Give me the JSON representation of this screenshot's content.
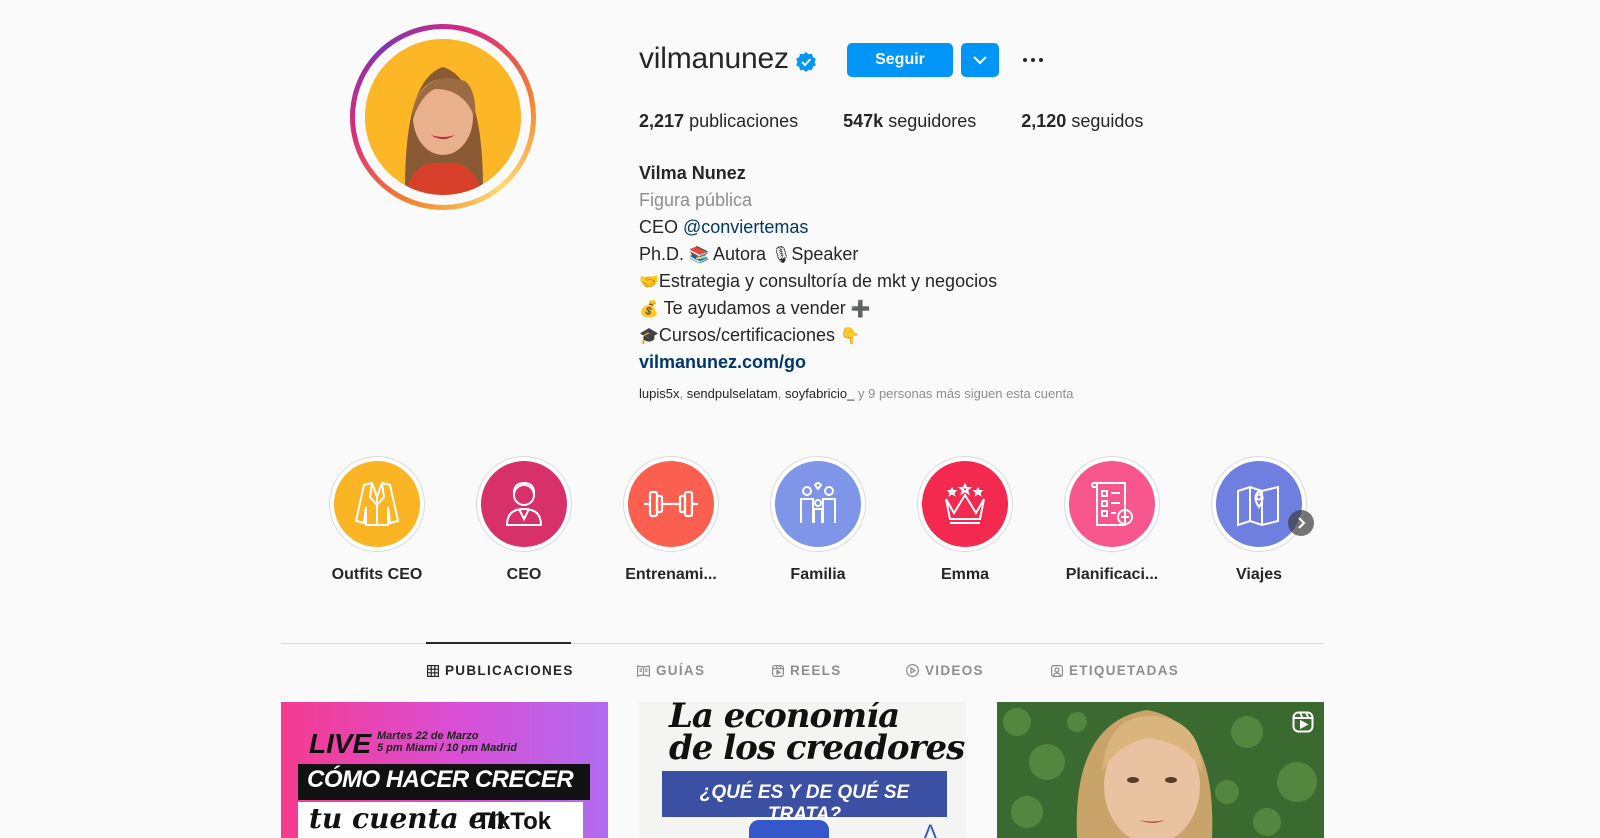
{
  "profile": {
    "username": "vilmanunez",
    "follow_label": "Seguir",
    "stats": {
      "posts_value": "2,217",
      "posts_label": "publicaciones",
      "followers_value": "547k",
      "followers_label": "seguidores",
      "following_value": "2,120",
      "following_label": "seguidos"
    },
    "bio": {
      "name": "Vilma Nunez",
      "category": "Figura pública",
      "line1_prefix": "CEO ",
      "line1_mention": "@conviertemas",
      "line2_a": "Ph.D. ",
      "line2_b": " Autora ",
      "line2_c": "Speaker",
      "line3": "Estrategia y consultoría de mkt y negocios",
      "line4": " Te ayudamos a vender",
      "line5": "Cursos/certificaciones",
      "website": "vilmanunez.com/go"
    },
    "followed_by": {
      "users": [
        "lupis5x",
        "sendpulselatam",
        "soyfabricio_"
      ],
      "suffix": " y 9 personas más siguen esta cuenta"
    }
  },
  "highlights": [
    {
      "label": "Outfits CEO",
      "color": "#fbb424",
      "icon": "blazer-icon"
    },
    {
      "label": "CEO",
      "color": "#d8316a",
      "icon": "businesswoman-icon"
    },
    {
      "label": "Entrenami...",
      "color": "#fb5f4f",
      "icon": "dumbbell-icon"
    },
    {
      "label": "Familia",
      "color": "#7e95e8",
      "icon": "family-icon"
    },
    {
      "label": "Emma",
      "color": "#f4294f",
      "icon": "crown-icon"
    },
    {
      "label": "Planificaci...",
      "color": "#f7578d",
      "icon": "checklist-icon"
    },
    {
      "label": "Viajes",
      "color": "#6e7fe0",
      "icon": "map-icon"
    }
  ],
  "tabs": [
    {
      "label": "PUBLICACIONES",
      "icon": "grid-icon",
      "active": true
    },
    {
      "label": "GUÍAS",
      "icon": "guide-icon",
      "active": false
    },
    {
      "label": "REELS",
      "icon": "reels-icon",
      "active": false
    },
    {
      "label": "VIDEOS",
      "icon": "video-icon",
      "active": false
    },
    {
      "label": "ETIQUETADAS",
      "icon": "tagged-icon",
      "active": false
    }
  ],
  "posts": [
    {
      "live": "LIVE",
      "date": "Martes 22 de Marzo",
      "time": "5 pm Miami / 10 pm Madrid",
      "headline": "CÓMO HACER CRECER",
      "subline": "tu cuenta en",
      "brand": "TikTok"
    },
    {
      "title1": "La economía",
      "title2": "de los creadores",
      "banner": "¿QUÉ ES Y DE QUÉ SE TRATA?"
    },
    {
      "type_icon": "reels-icon"
    }
  ],
  "colors": {
    "accent": "#0095f6",
    "link": "#00376b",
    "muted": "#8e8e8e"
  }
}
